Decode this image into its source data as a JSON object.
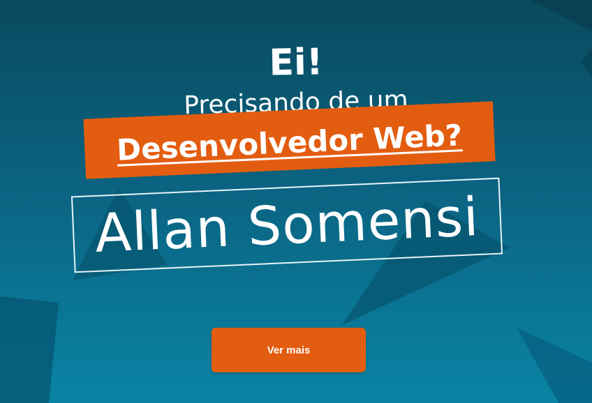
{
  "hero": {
    "greeting": "Ei!",
    "line1": "Precisando de um",
    "highlight": "Desenvolvedor Web?",
    "name": "Allan Somensi",
    "button_label": "Ver mais"
  },
  "colors": {
    "accent": "#e35d10",
    "background_top": "#0a4a5e",
    "background_bottom": "#0a84a4"
  }
}
